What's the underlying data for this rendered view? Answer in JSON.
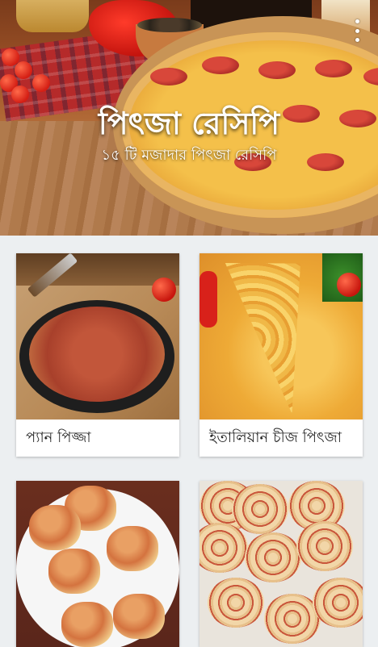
{
  "header": {
    "title": "পিৎজা রেসিপি",
    "subtitle": "১৫ টি মজাদার পিৎজা রেসিপি",
    "overflow_icon": "more-vert-icon"
  },
  "recipes": [
    {
      "label": "প্যান পিজ্জা",
      "image": "pan-pizza"
    },
    {
      "label": "ইতালিয়ান চীজ পিৎজা",
      "image": "italian-cheese-pizza"
    },
    {
      "label": "",
      "image": "pizza-muffins"
    },
    {
      "label": "",
      "image": "pizza-pinwheels"
    }
  ],
  "colors": {
    "background": "#eceff1",
    "card": "#ffffff",
    "text": "#222222"
  }
}
